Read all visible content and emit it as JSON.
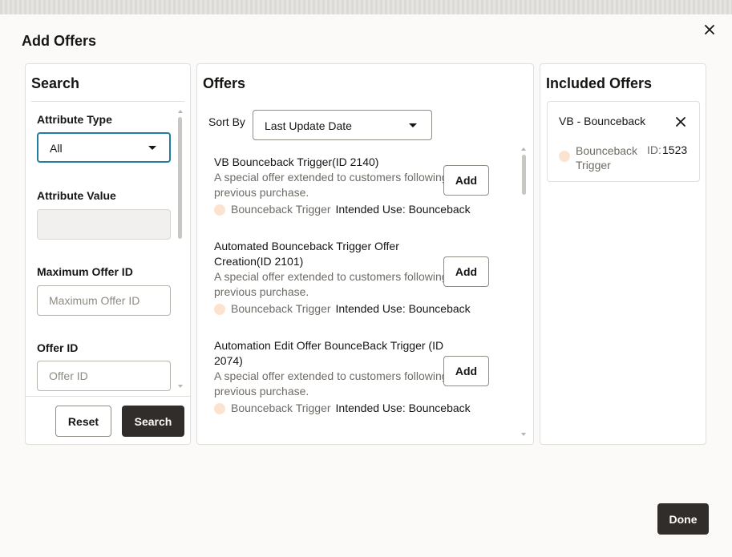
{
  "dialog": {
    "title": "Add Offers",
    "done_label": "Done"
  },
  "search": {
    "title": "Search",
    "attribute_type_label": "Attribute Type",
    "attribute_type_value": "All",
    "attribute_value_label": "Attribute Value",
    "max_offer_id_label": "Maximum Offer ID",
    "max_offer_id_placeholder": "Maximum Offer ID",
    "offer_id_label": "Offer ID",
    "offer_id_placeholder": "Offer ID",
    "reset_label": "Reset",
    "search_label": "Search"
  },
  "offers": {
    "title": "Offers",
    "sort_label": "Sort By",
    "sort_value": "Last Update Date",
    "add_label": "Add",
    "items": [
      {
        "title": "VB Bounceback Trigger(ID 2140)",
        "description": "A special offer extended to customers following a previous purchase.",
        "type": "Bounceback Trigger",
        "intended_use": "Intended Use: Bounceback"
      },
      {
        "title": "Automated Bounceback Trigger Offer Creation(ID 2101)",
        "description": "A special offer extended to customers following a previous purchase.",
        "type": "Bounceback Trigger",
        "intended_use": "Intended Use: Bounceback"
      },
      {
        "title": "Automation Edit Offer BounceBack Trigger (ID 2074)",
        "description": "A special offer extended to customers following a previous purchase.",
        "type": "Bounceback Trigger",
        "intended_use": "Intended Use: Bounceback"
      }
    ]
  },
  "included": {
    "title": "Included Offers",
    "items": [
      {
        "name": "VB - Bounceback",
        "type": "Bounceback Trigger",
        "id_label": "ID:",
        "id_value": "1523"
      }
    ]
  },
  "colors": {
    "accent": "#227e9e",
    "dark_button": "#312d2a",
    "type_dot": "#fbe3cf"
  },
  "icons": {
    "close": "close-icon",
    "remove": "remove-icon",
    "dropdown": "chevron-down-icon"
  }
}
